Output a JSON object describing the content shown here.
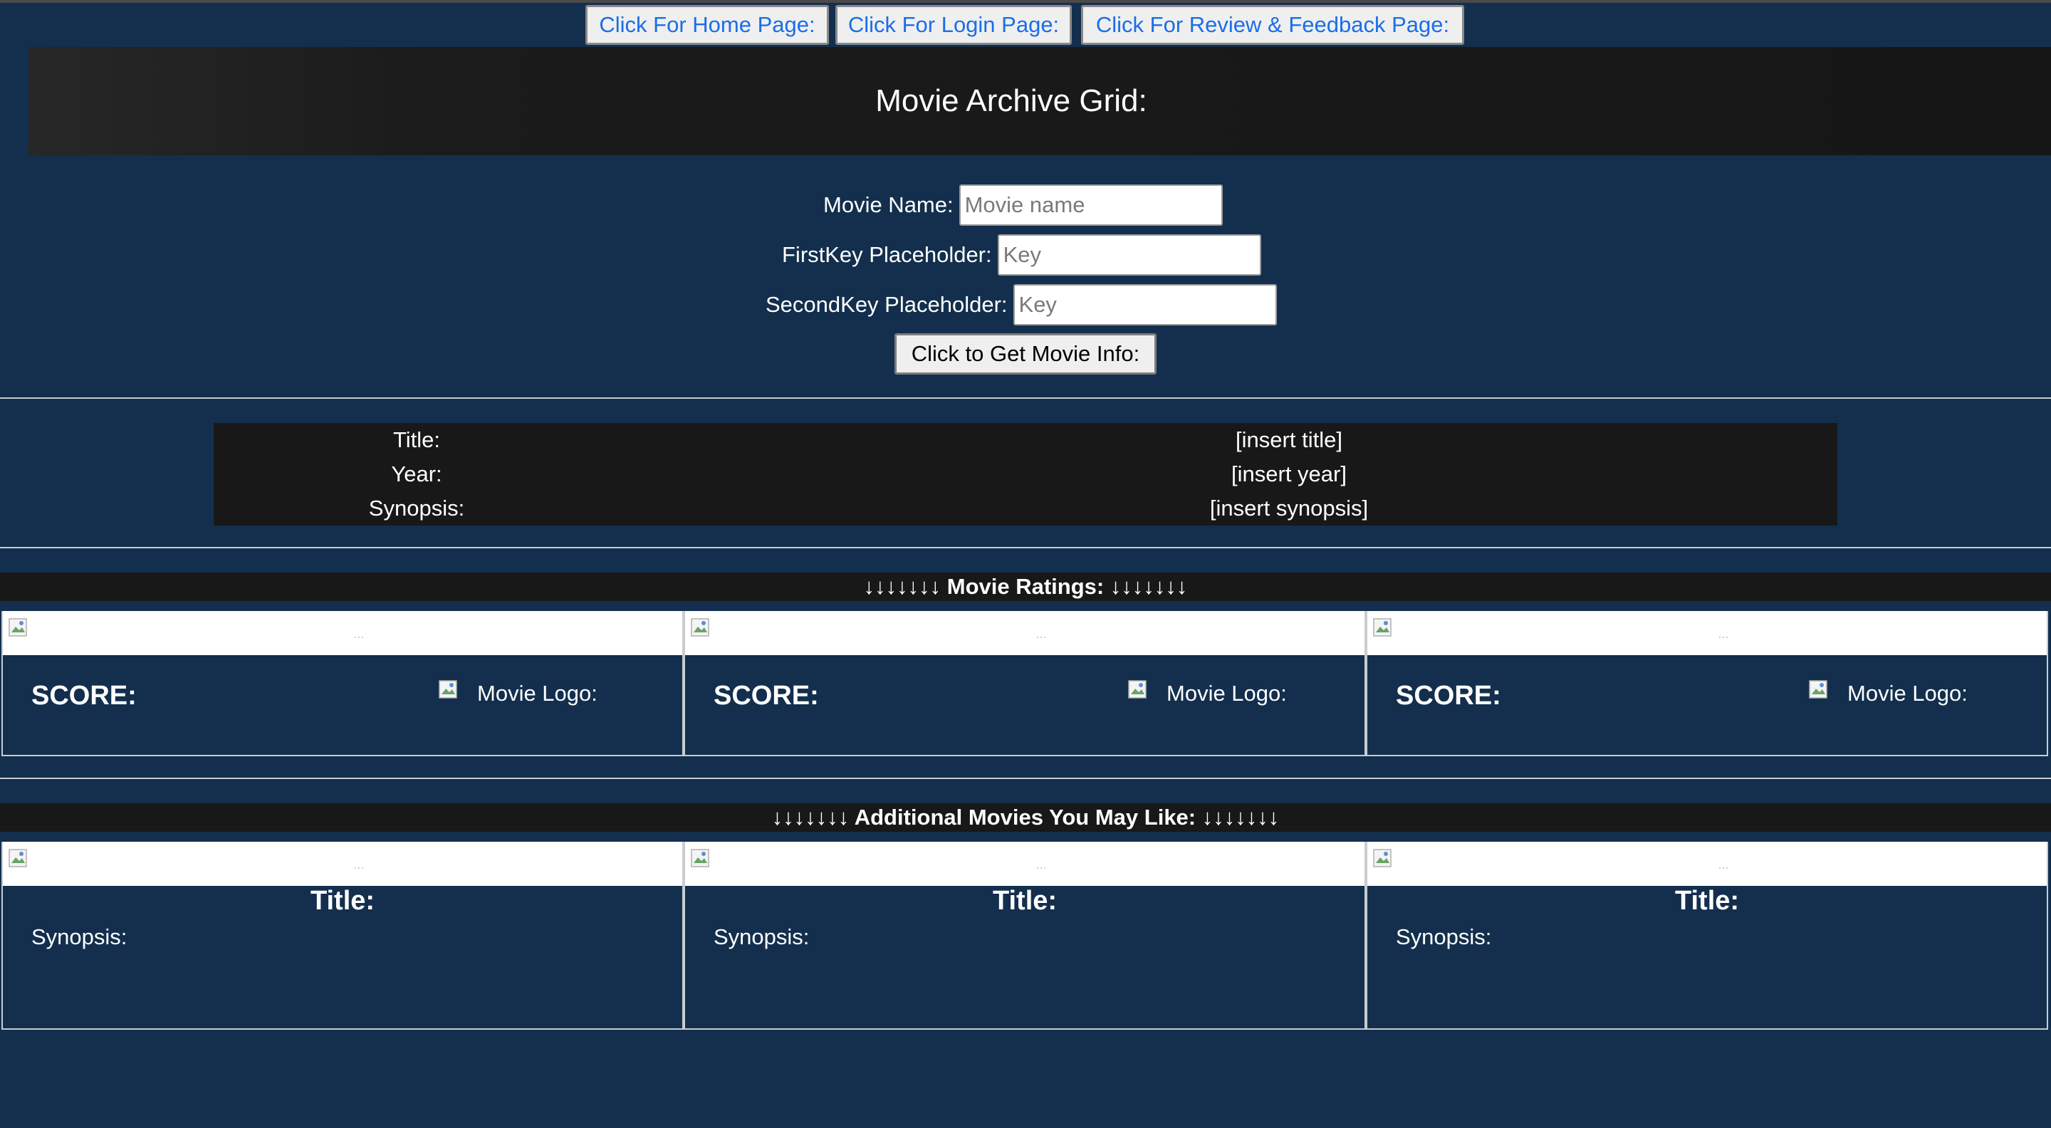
{
  "nav": {
    "home": "Click For Home Page:",
    "login": "Click For Login Page:",
    "review": "Click For Review & Feedback Page:"
  },
  "header": {
    "title": "Movie Archive Grid:"
  },
  "form": {
    "movie_name_label": "Movie Name:",
    "movie_name_placeholder": "Movie name",
    "first_key_label": "FirstKey Placeholder:",
    "first_key_placeholder": "Key",
    "second_key_label": "SecondKey Placeholder:",
    "second_key_placeholder": "Key",
    "submit_label": "Click to Get Movie Info:"
  },
  "info": {
    "rows": [
      {
        "label": "Title:",
        "value": "[insert title]"
      },
      {
        "label": "Year:",
        "value": "[insert year]"
      },
      {
        "label": "Synopsis:",
        "value": "[insert synopsis]"
      }
    ]
  },
  "ratings": {
    "header": "↓↓↓↓↓↓↓ Movie Ratings: ↓↓↓↓↓↓↓",
    "cards": [
      {
        "score_label": "SCORE:",
        "logo_label": "Movie Logo:",
        "img_alt": "..."
      },
      {
        "score_label": "SCORE:",
        "logo_label": "Movie Logo:",
        "img_alt": "..."
      },
      {
        "score_label": "SCORE:",
        "logo_label": "Movie Logo:",
        "img_alt": "..."
      }
    ]
  },
  "additional": {
    "header": "↓↓↓↓↓↓↓ Additional Movies You May Like: ↓↓↓↓↓↓↓",
    "cards": [
      {
        "title_label": "Title:",
        "synopsis_label": "Synopsis:",
        "img_alt": "..."
      },
      {
        "title_label": "Title:",
        "synopsis_label": "Synopsis:",
        "img_alt": "..."
      },
      {
        "title_label": "Title:",
        "synopsis_label": "Synopsis:",
        "img_alt": "..."
      }
    ]
  },
  "colors": {
    "background": "#132f4d",
    "panel": "#181818",
    "link": "#1a6ee8"
  }
}
